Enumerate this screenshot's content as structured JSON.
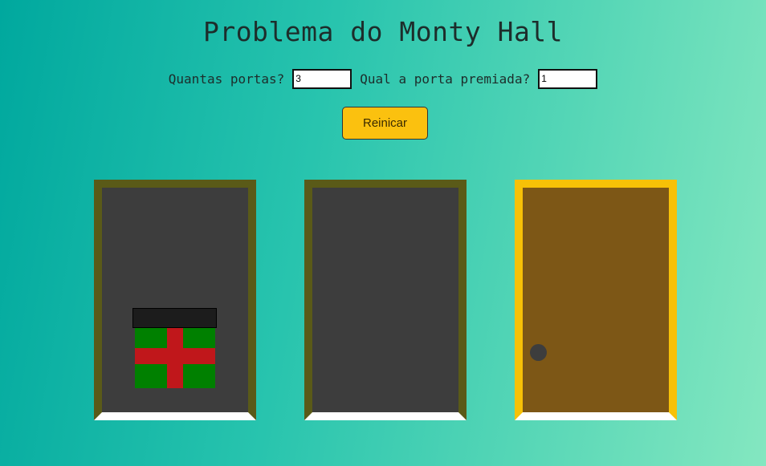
{
  "title": "Problema do Monty Hall",
  "form": {
    "doors_label": "Quantas portas?",
    "doors_value": "3",
    "prize_label": "Qual a porta premiada?",
    "prize_value": "1"
  },
  "reset_label": "Reinicar",
  "doors": [
    {
      "state": "open",
      "has_gift": true,
      "selected": false
    },
    {
      "state": "open",
      "has_gift": false,
      "selected": false
    },
    {
      "state": "closed",
      "has_gift": false,
      "selected": true
    }
  ],
  "colors": {
    "frame": "#5a5a18",
    "frame_selected": "#f7c107",
    "door": "#7d5716",
    "interior": "#3d3d3d",
    "button": "#fbc10f",
    "gift_box": "#008000",
    "gift_ribbon": "#c0171b"
  },
  "icons": [
    "gift-icon",
    "door-knob"
  ]
}
